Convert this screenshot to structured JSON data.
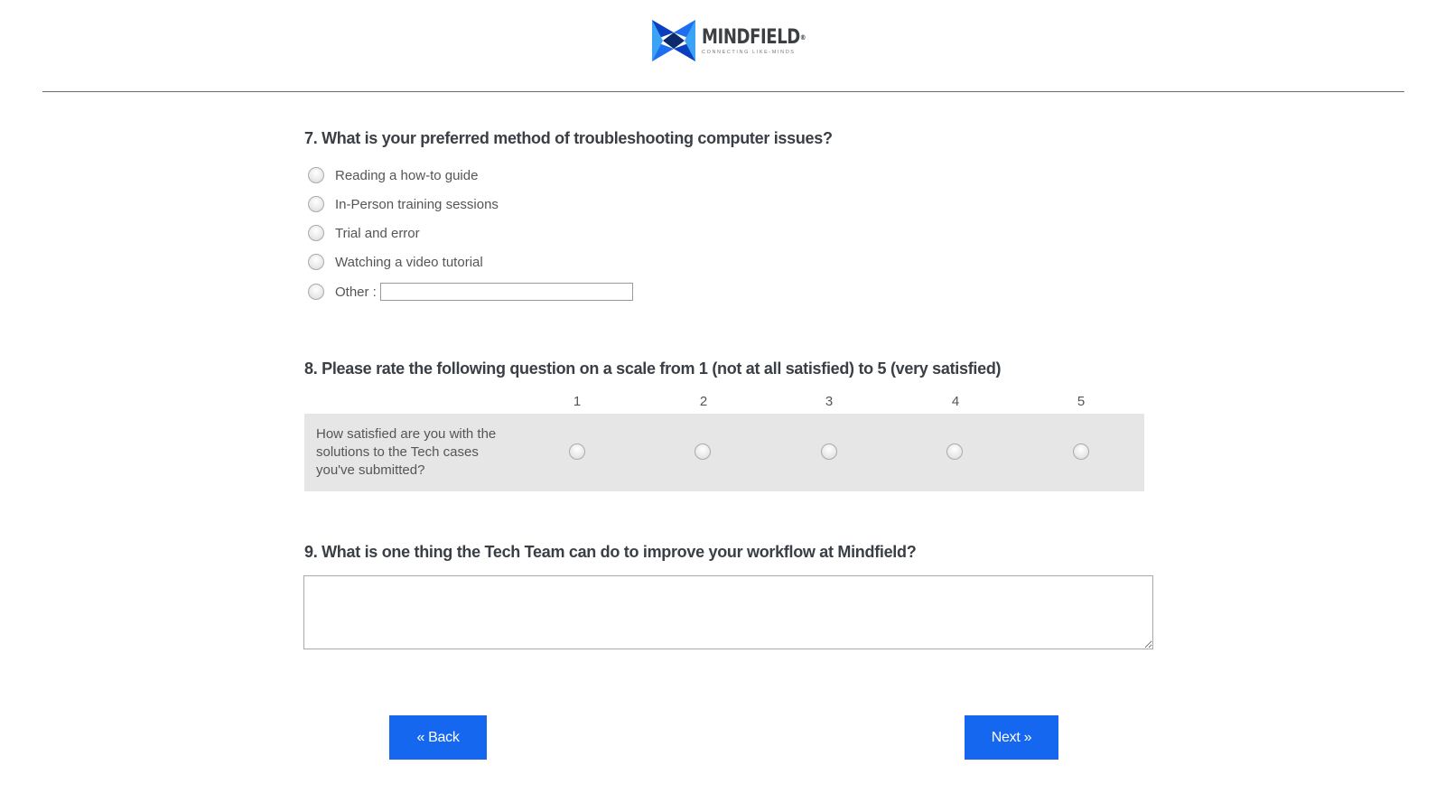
{
  "header": {
    "logo_name": "MINDFIELD",
    "logo_registered": "®",
    "logo_tagline": "CONNECTING LIKE-MINDS",
    "brand_colors": {
      "dark_blue": "#0a3fbf",
      "mid_blue": "#1e6ff0",
      "light_blue": "#3aa3f5",
      "navy": "#0b2a6b"
    }
  },
  "q7": {
    "title": "7. What is your preferred method of troubleshooting computer issues?",
    "options": [
      {
        "label": "Reading a how-to guide"
      },
      {
        "label": "In-Person training sessions"
      },
      {
        "label": "Trial and error"
      },
      {
        "label": "Watching a video tutorial"
      },
      {
        "label": "Other :"
      }
    ],
    "other_value": ""
  },
  "q8": {
    "title": "8. Please rate the following question on a scale from 1 (not at all satisfied) to 5 (very satisfied)",
    "scale": [
      "1",
      "2",
      "3",
      "4",
      "5"
    ],
    "row_label": "How satisfied are you with the solutions to the Tech cases you've submitted?"
  },
  "q9": {
    "title": "9. What is one thing the Tech Team can do to improve your workflow at Mindfield?",
    "answer_value": ""
  },
  "nav": {
    "back_label": "« Back",
    "next_label": "Next »",
    "button_color": "#1667f0"
  }
}
